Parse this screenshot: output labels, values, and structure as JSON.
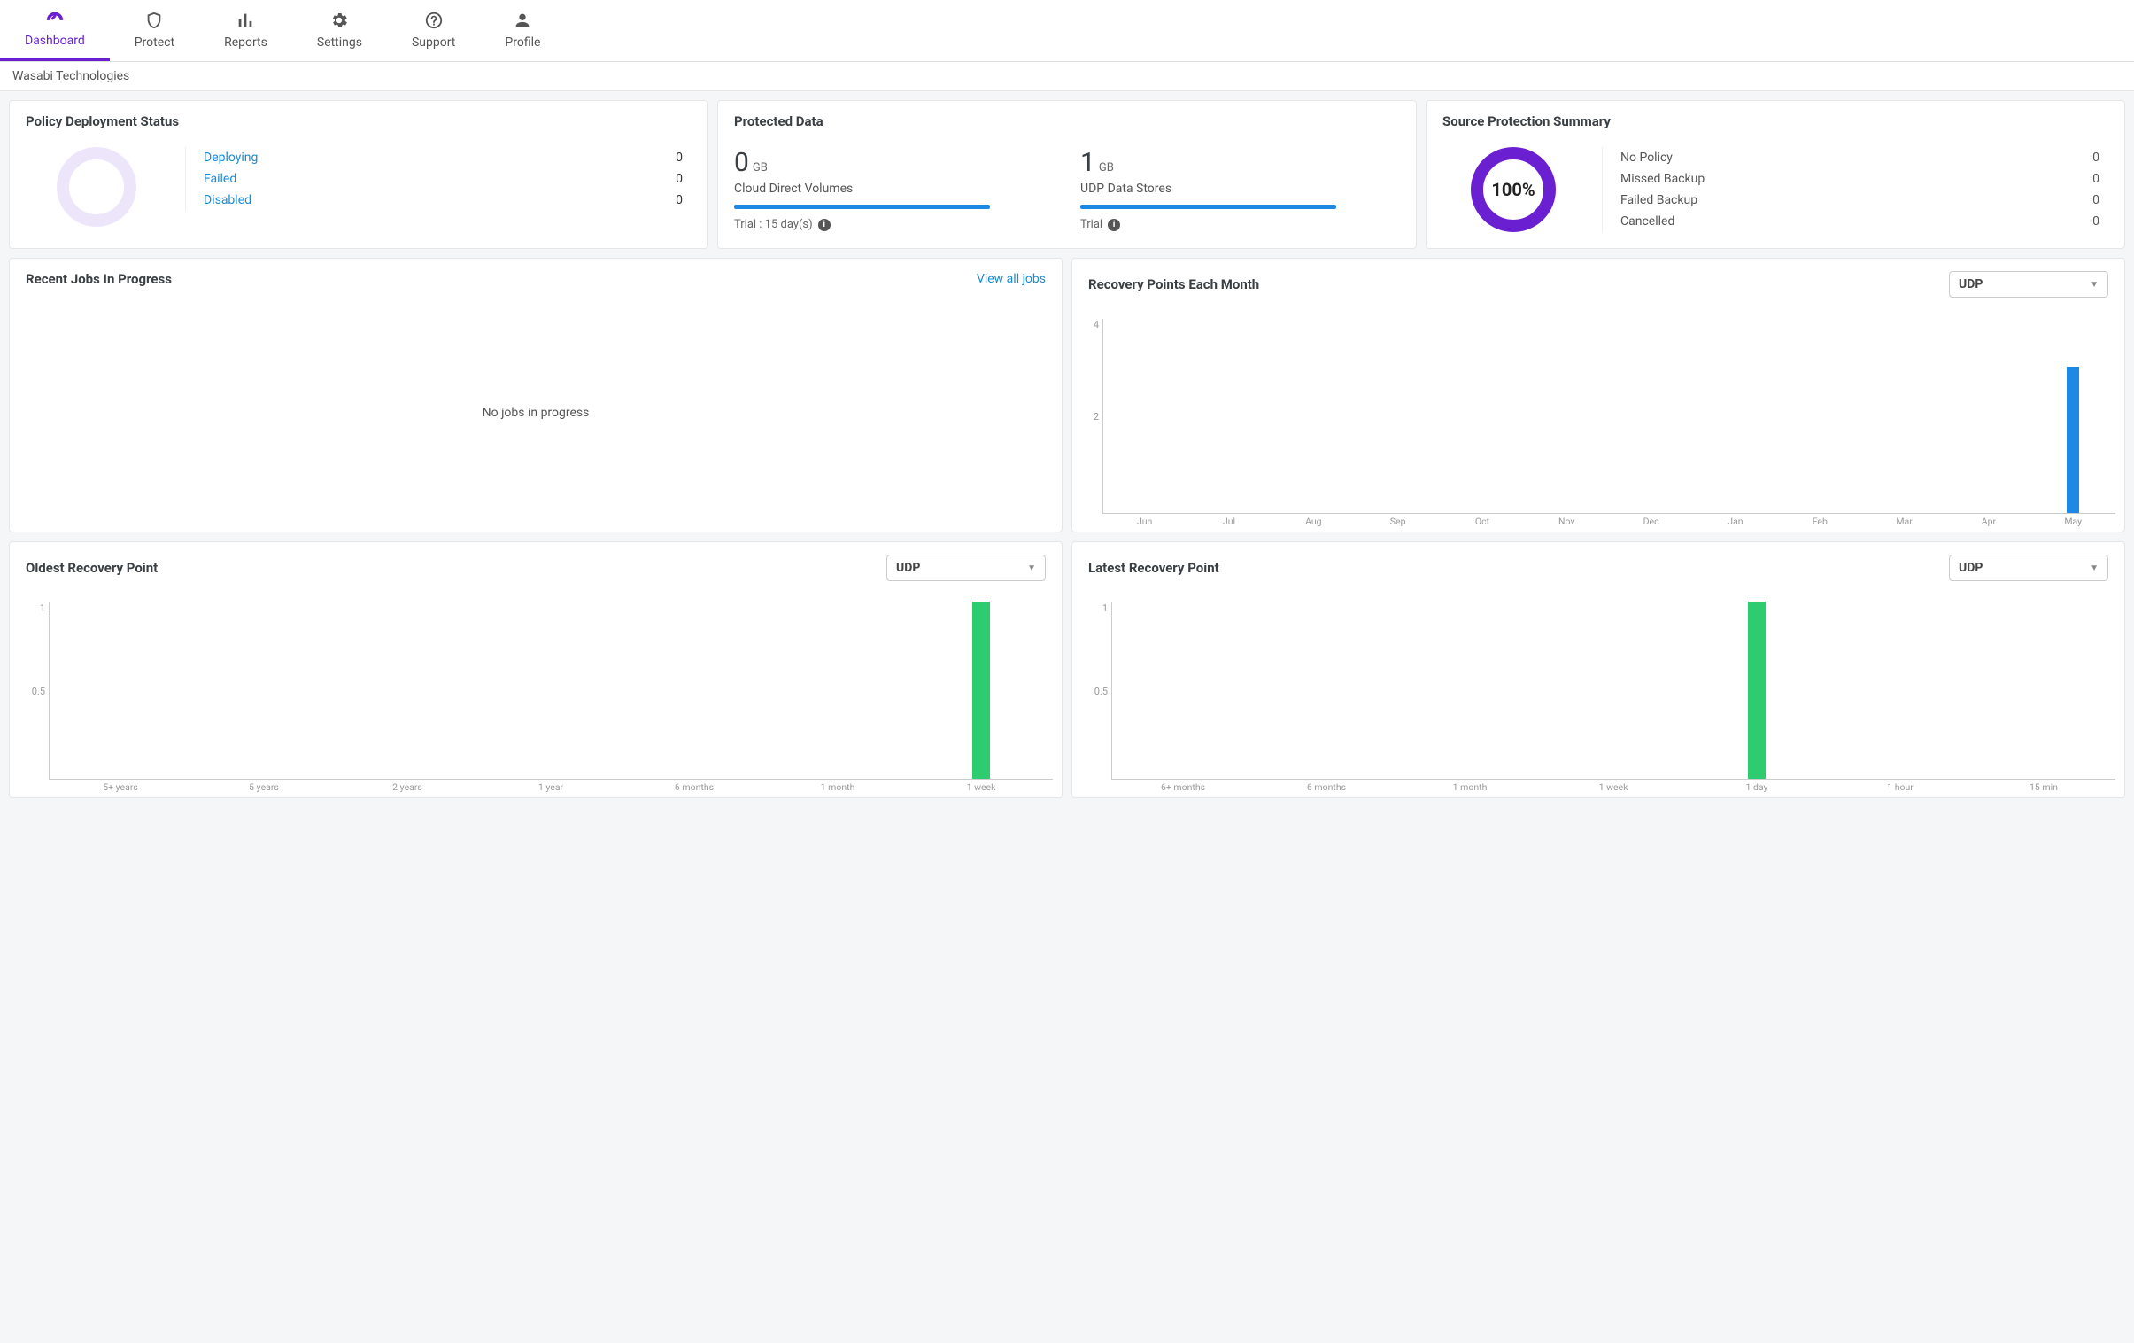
{
  "nav": {
    "items": [
      {
        "label": "Dashboard",
        "active": true
      },
      {
        "label": "Protect",
        "active": false
      },
      {
        "label": "Reports",
        "active": false
      },
      {
        "label": "Settings",
        "active": false
      },
      {
        "label": "Support",
        "active": false
      },
      {
        "label": "Profile",
        "active": false
      }
    ]
  },
  "breadcrumb": "Wasabi Technologies",
  "policy_deployment": {
    "title": "Policy Deployment Status",
    "rows": [
      {
        "label": "Deploying",
        "value": 0
      },
      {
        "label": "Failed",
        "value": 0
      },
      {
        "label": "Disabled",
        "value": 0
      }
    ]
  },
  "protected_data": {
    "title": "Protected Data",
    "cols": [
      {
        "value": 0,
        "unit": "GB",
        "label": "Cloud Direct Volumes",
        "trial": "Trial : 15 day(s)"
      },
      {
        "value": 1,
        "unit": "GB",
        "label": "UDP Data Stores",
        "trial": "Trial"
      }
    ]
  },
  "source_protection": {
    "title": "Source Protection Summary",
    "percent": "100%",
    "rows": [
      {
        "label": "No Policy",
        "value": 0
      },
      {
        "label": "Missed Backup",
        "value": 0
      },
      {
        "label": "Failed Backup",
        "value": 0
      },
      {
        "label": "Cancelled",
        "value": 0
      }
    ]
  },
  "recent_jobs": {
    "title": "Recent Jobs In Progress",
    "view_all": "View all jobs",
    "empty": "No jobs in progress"
  },
  "recovery_points_month": {
    "title": "Recovery Points Each Month",
    "dropdown": "UDP"
  },
  "oldest_recovery": {
    "title": "Oldest Recovery Point",
    "dropdown": "UDP"
  },
  "latest_recovery": {
    "title": "Latest Recovery Point",
    "dropdown": "UDP"
  },
  "chart_data": [
    {
      "id": "recovery_points_month",
      "type": "bar",
      "categories": [
        "Jun",
        "Jul",
        "Aug",
        "Sep",
        "Oct",
        "Nov",
        "Dec",
        "Jan",
        "Feb",
        "Mar",
        "Apr",
        "May"
      ],
      "values": [
        0,
        0,
        0,
        0,
        0,
        0,
        0,
        0,
        0,
        0,
        0,
        3
      ],
      "yticks": [
        4,
        2
      ],
      "ylim": [
        0,
        4
      ],
      "color": "#1e88e5"
    },
    {
      "id": "oldest_recovery",
      "type": "bar",
      "categories": [
        "5+ years",
        "5 years",
        "2 years",
        "1 year",
        "6 months",
        "1 month",
        "1 week"
      ],
      "values": [
        0,
        0,
        0,
        0,
        0,
        0,
        1
      ],
      "yticks": [
        1,
        0.5
      ],
      "ylim": [
        0,
        1
      ],
      "color": "#2ecc71"
    },
    {
      "id": "latest_recovery",
      "type": "bar",
      "categories": [
        "6+ months",
        "6 months",
        "1 month",
        "1 week",
        "1 day",
        "1 hour",
        "15 min"
      ],
      "values": [
        0,
        0,
        0,
        0,
        1,
        0,
        0
      ],
      "yticks": [
        1,
        0.5
      ],
      "ylim": [
        0,
        1
      ],
      "color": "#2ecc71"
    }
  ]
}
